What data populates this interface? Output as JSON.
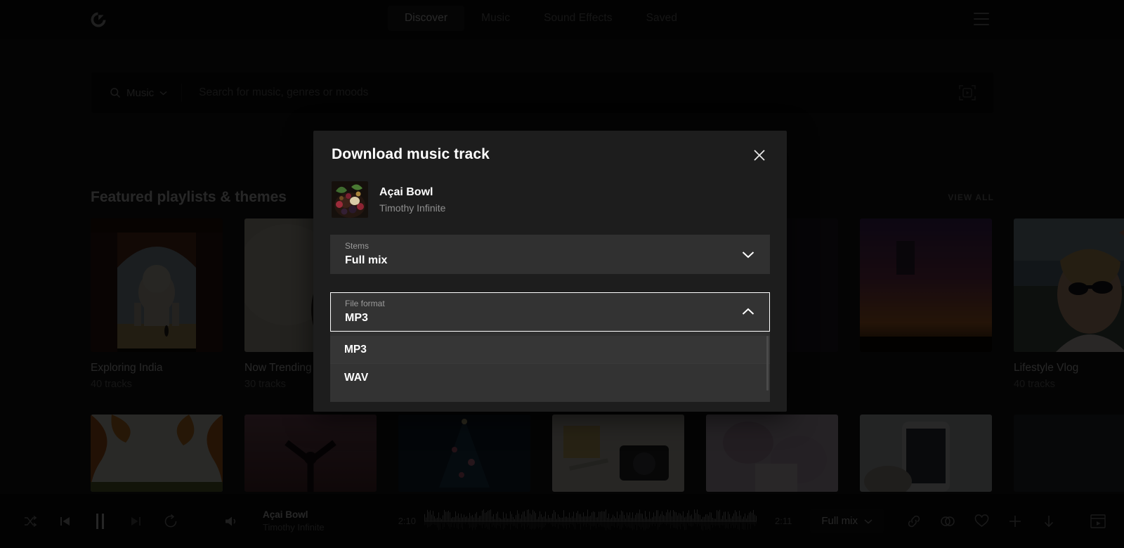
{
  "app": {
    "logo_name": "epidemic-sound-logo"
  },
  "header": {
    "nav": [
      {
        "label": "Discover",
        "active": true
      },
      {
        "label": "Music",
        "active": false
      },
      {
        "label": "Sound Effects",
        "active": false
      },
      {
        "label": "Saved",
        "active": false
      }
    ],
    "menu_icon": "hamburger-menu-icon"
  },
  "search": {
    "type_label": "Music",
    "type_chevron": "chevron-down-icon",
    "search_icon": "search-icon",
    "placeholder": "Search for music, genres or moods",
    "value": "",
    "right_icon": "video-search-icon"
  },
  "main": {
    "section_title": "Featured playlists & themes",
    "view_all_label": "VIEW ALL",
    "playlists": [
      {
        "title": "Exploring India",
        "tracks": "40 tracks"
      },
      {
        "title": "Now Trending",
        "tracks": "30 tracks"
      },
      {
        "title": "",
        "tracks": ""
      },
      {
        "title": "",
        "tracks": ""
      },
      {
        "title": "",
        "tracks": ""
      },
      {
        "title": "",
        "tracks": ""
      },
      {
        "title": "Lifestyle Vlog",
        "tracks": "40 tracks"
      }
    ]
  },
  "modal": {
    "title": "Download music track",
    "close_icon": "close-icon",
    "track": {
      "title": "Açai Bowl",
      "artist": "Timothy Infinite",
      "artwork_name": "acai-bowl-artwork"
    },
    "stems_field": {
      "label": "Stems",
      "value": "Full mix",
      "chevron": "chevron-down-icon",
      "expanded": false
    },
    "format_field": {
      "label": "File format",
      "value": "MP3",
      "chevron": "chevron-up-icon",
      "expanded": true
    },
    "format_options": [
      {
        "label": "MP3",
        "selected": true
      },
      {
        "label": "WAV",
        "selected": false
      }
    ]
  },
  "player": {
    "controls": [
      {
        "name": "shuffle-button",
        "icon": "shuffle-icon"
      },
      {
        "name": "previous-button",
        "icon": "skip-previous-icon"
      },
      {
        "name": "pause-button",
        "icon": "pause-icon"
      },
      {
        "name": "next-button",
        "icon": "skip-next-icon"
      },
      {
        "name": "repeat-button",
        "icon": "repeat-icon"
      },
      {
        "name": "volume-button",
        "icon": "volume-icon"
      }
    ],
    "track": {
      "title": "Açai Bowl",
      "artist": "Timothy Infinite"
    },
    "current_time": "2:10",
    "total_time": "2:11",
    "stems_label": "Full mix",
    "stems_chevron": "chevron-down-icon",
    "actions": [
      {
        "name": "copy-link-button",
        "icon": "link-icon"
      },
      {
        "name": "similar-tracks-button",
        "icon": "overlapping-circles-icon"
      },
      {
        "name": "favorite-button",
        "icon": "heart-icon"
      },
      {
        "name": "add-to-project-button",
        "icon": "plus-icon"
      },
      {
        "name": "download-button",
        "icon": "download-arrow-icon"
      },
      {
        "name": "video-preview-button",
        "icon": "video-window-icon"
      }
    ]
  },
  "colors": {
    "background": "#0a0a0a",
    "modal_bg": "#1d1d1d",
    "field_bg": "#303030",
    "accent_border": "#ffffff",
    "text_primary": "#ffffff",
    "text_secondary": "#8f8f8f"
  }
}
